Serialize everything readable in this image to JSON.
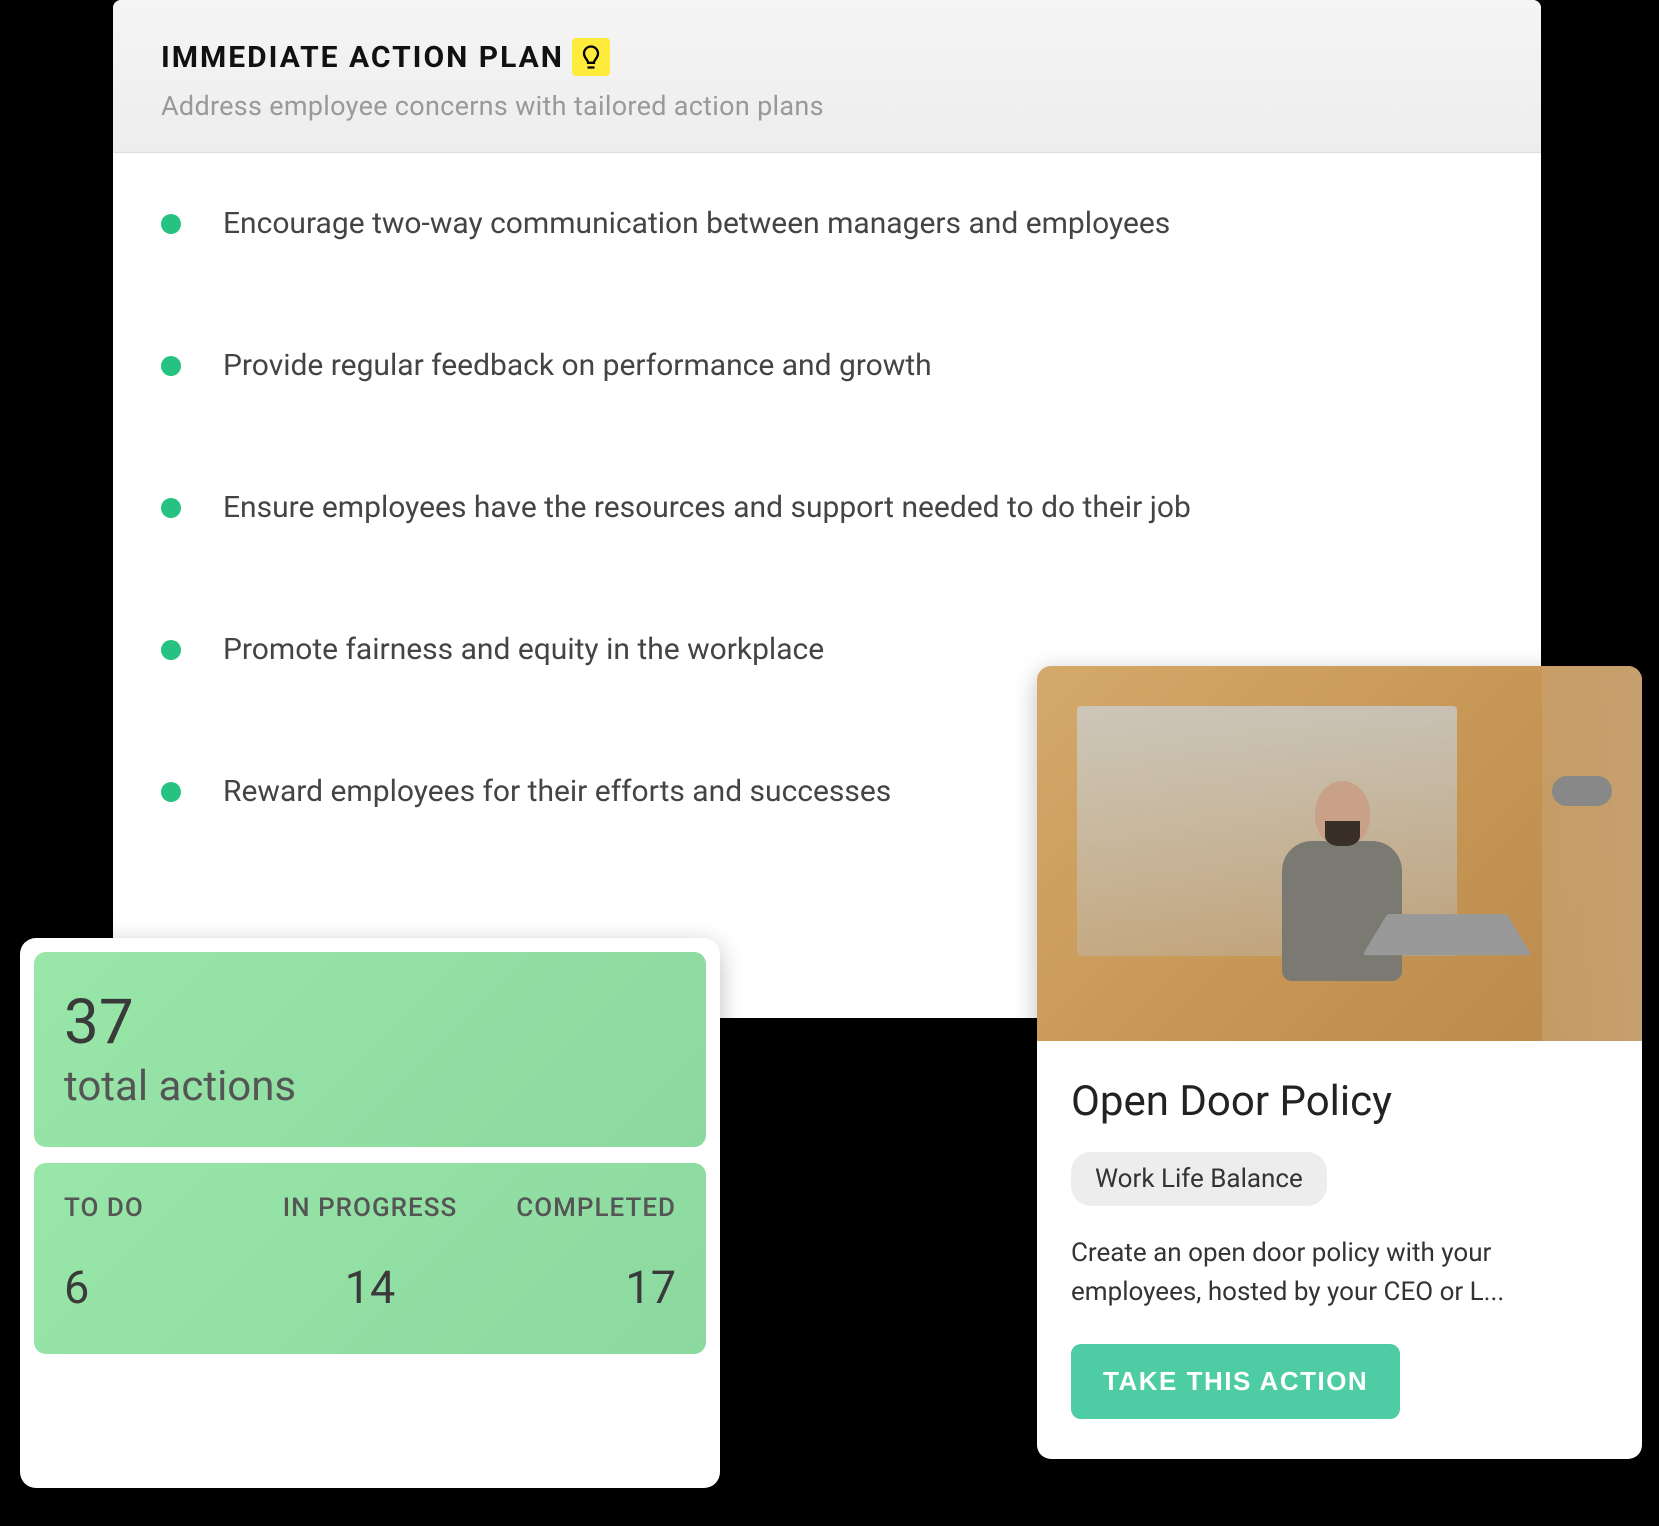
{
  "header": {
    "title": "IMMEDIATE ACTION PLAN",
    "subtitle": "Address employee concerns with tailored action plans"
  },
  "plan_items": [
    "Encourage two-way communication between managers and employees",
    "Provide regular feedback on performance and growth",
    "Ensure employees have the resources and support needed to do their job",
    "Promote fairness and equity in the workplace",
    "Reward employees for their efforts and successes"
  ],
  "stats": {
    "total": "37",
    "total_label": "total actions",
    "columns": [
      {
        "title": "TO DO",
        "value": "6"
      },
      {
        "title": "IN PROGRESS",
        "value": "14"
      },
      {
        "title": "COMPLETED",
        "value": "17"
      }
    ]
  },
  "action_card": {
    "title": "Open Door Policy",
    "tag": "Work Life Balance",
    "description": "Create an open door policy with your employees, hosted by your CEO or L...",
    "button": "TAKE THIS ACTION"
  }
}
